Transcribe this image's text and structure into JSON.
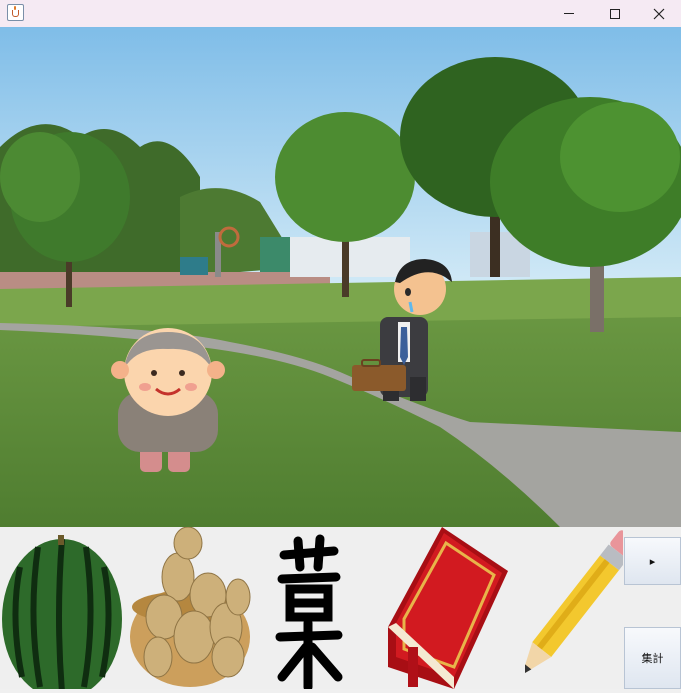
{
  "window": {
    "title": "",
    "controls": {
      "minimize": "minimize",
      "maximize": "maximize",
      "close": "close"
    }
  },
  "scene": {
    "background": "park-photo",
    "characters": [
      "elderly-woman",
      "sad-businessman"
    ]
  },
  "items": [
    {
      "name": "watermelon",
      "icon": "watermelon-icon"
    },
    {
      "name": "potatoes",
      "icon": "potato-basket-icon"
    },
    {
      "name": "kanji-character",
      "icon": "kanji-icon"
    },
    {
      "name": "book",
      "icon": "book-icon"
    },
    {
      "name": "pencil",
      "icon": "pencil-icon"
    }
  ],
  "buttons": {
    "next_label": "▸",
    "tally_label": "集計"
  },
  "colors": {
    "titlebar": "#f5eaf3",
    "sky": "#9fd0ee",
    "grass": "#5f8f3c",
    "path": "#9a9a9a",
    "book_red": "#c4141a"
  }
}
